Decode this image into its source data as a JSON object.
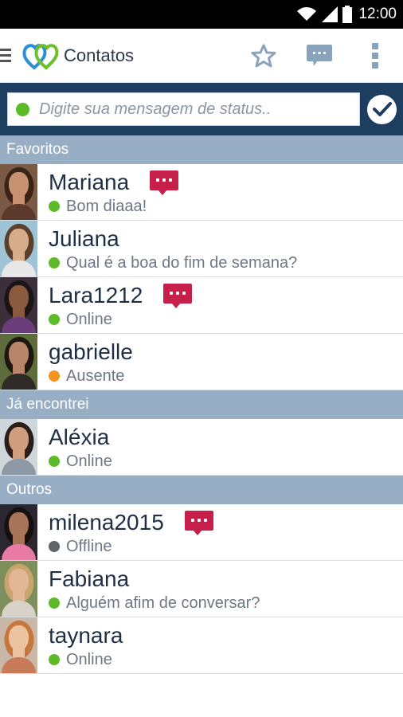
{
  "statusbar": {
    "time": "12:00"
  },
  "appbar": {
    "title": "Contatos"
  },
  "status_input": {
    "placeholder": "Digite sua mensagem de status.."
  },
  "colors": {
    "online": "#5dbb2a",
    "away": "#f39321",
    "offline": "#5f6469",
    "accent": "#1e3e61",
    "section": "#97aec4",
    "message_badge": "#c51f4a"
  },
  "sections": [
    {
      "title": "Favoritos",
      "contacts": [
        {
          "name": "Mariana",
          "status": "Bom diaaa!",
          "presence": "online",
          "has_message": true
        },
        {
          "name": "Juliana",
          "status": "Qual é a boa do fim de semana?",
          "presence": "online",
          "has_message": false
        },
        {
          "name": "Lara1212",
          "status": "Online",
          "presence": "online",
          "has_message": true
        },
        {
          "name": "gabrielle",
          "status": "Ausente",
          "presence": "away",
          "has_message": false
        }
      ]
    },
    {
      "title": "Já encontrei",
      "contacts": [
        {
          "name": "Aléxia",
          "status": "Online",
          "presence": "online",
          "has_message": false
        }
      ]
    },
    {
      "title": "Outros",
      "contacts": [
        {
          "name": "milena2015",
          "status": "Offline",
          "presence": "offline",
          "has_message": true
        },
        {
          "name": "Fabiana",
          "status": "Alguém afim de conversar?",
          "presence": "online",
          "has_message": false
        },
        {
          "name": "taynara",
          "status": "Online",
          "presence": "online",
          "has_message": false
        }
      ]
    }
  ],
  "icons": {
    "menu": "hamburger-menu-icon",
    "logo": "hearts-logo-icon",
    "favorites": "star-icon",
    "messages": "chat-bubble-icon",
    "overflow": "more-vert-icon",
    "confirm": "check-circle-icon"
  }
}
